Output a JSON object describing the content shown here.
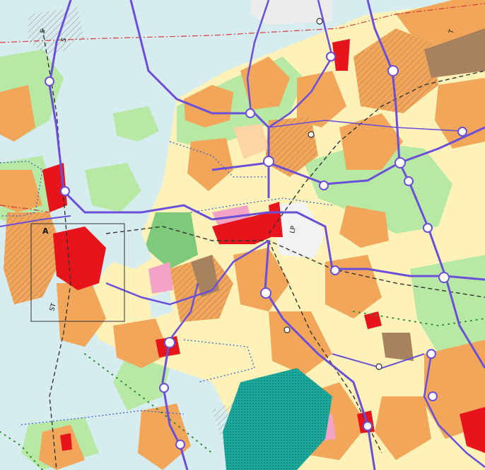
{
  "map": {
    "labels": {
      "s_north_1": "S",
      "s_north_2": "S",
      "t_northeast": "T",
      "st_west": "ST",
      "lp_center": "LP",
      "marker_a": "A"
    },
    "colors": {
      "water": "#d6ecef",
      "residential": "#f2a65a",
      "residential_light": "#fbd5a6",
      "center": "#e8141c",
      "green": "#b7e8a4",
      "green_dark": "#7fc97a",
      "industry": "#a8825f",
      "field": "#fff2b8",
      "pink": "#f2a3c6",
      "nature_reserve": "#18b2a4",
      "road": "#6b4fd8",
      "railway": "#333333",
      "boundary": "#d43a3a",
      "dotted": "#2b5ed8",
      "hatch": "#4a4a4a"
    }
  }
}
